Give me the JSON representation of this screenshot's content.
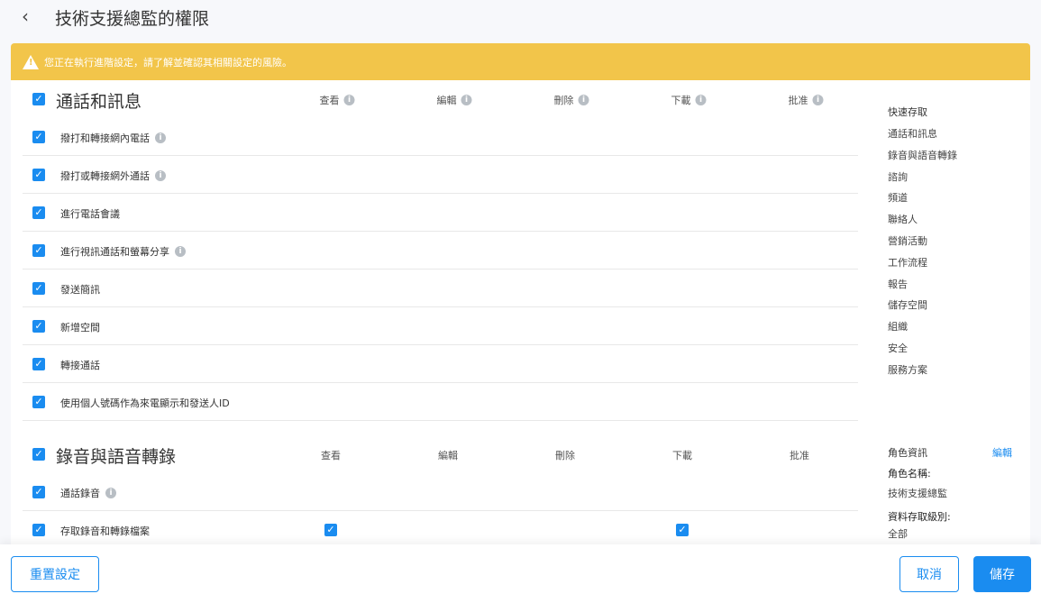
{
  "header": {
    "back_icon": "chevron-left-icon",
    "title": "技術支援總監的權限"
  },
  "banner": {
    "icon": "warning-icon",
    "text": "您正在執行進階設定，請了解並確認其相關設定的風險。",
    "color": "#f2c54a"
  },
  "columns": [
    "查看",
    "編輯",
    "刪除",
    "下載",
    "批准"
  ],
  "sections": [
    {
      "title": "通話和訊息",
      "checked": true,
      "rows": [
        {
          "label": "撥打和轉接網內電話",
          "checked": true,
          "info": true
        },
        {
          "label": "撥打或轉接網外通話",
          "checked": true,
          "info": true
        },
        {
          "label": "進行電話會議",
          "checked": true,
          "info": false
        },
        {
          "label": "進行視訊通話和螢幕分享",
          "checked": true,
          "info": true
        },
        {
          "label": "發送簡訊",
          "checked": true,
          "info": false
        },
        {
          "label": "新增空間",
          "checked": true,
          "info": false
        },
        {
          "label": "轉接通話",
          "checked": true,
          "info": false
        },
        {
          "label": "使用個人號碼作為來電顯示和發送人ID",
          "checked": true,
          "info": false
        }
      ]
    },
    {
      "title": "錄音與語音轉錄",
      "checked": true,
      "rows": [
        {
          "label": "通話錄音",
          "checked": true,
          "info": true
        },
        {
          "label": "存取錄音和轉錄檔案",
          "checked": true,
          "info": false,
          "view": true,
          "download": true
        }
      ]
    }
  ],
  "quick_access": {
    "title": "快速存取",
    "items": [
      "通話和訊息",
      "錄音與語音轉錄",
      "諮詢",
      "頻道",
      "聯絡人",
      "營銷活動",
      "工作流程",
      "報告",
      "儲存空間",
      "組織",
      "安全",
      "服務方案"
    ]
  },
  "role_info": {
    "title": "角色資訊",
    "edit_label": "編輯",
    "name_label": "角色名稱:",
    "name_value": "技術支援總監",
    "access_label": "資料存取級別:",
    "access_value": "全部"
  },
  "footer": {
    "reset_label": "重置設定",
    "cancel_label": "取消",
    "save_label": "儲存"
  },
  "colors": {
    "accent": "#1a8cf0"
  }
}
